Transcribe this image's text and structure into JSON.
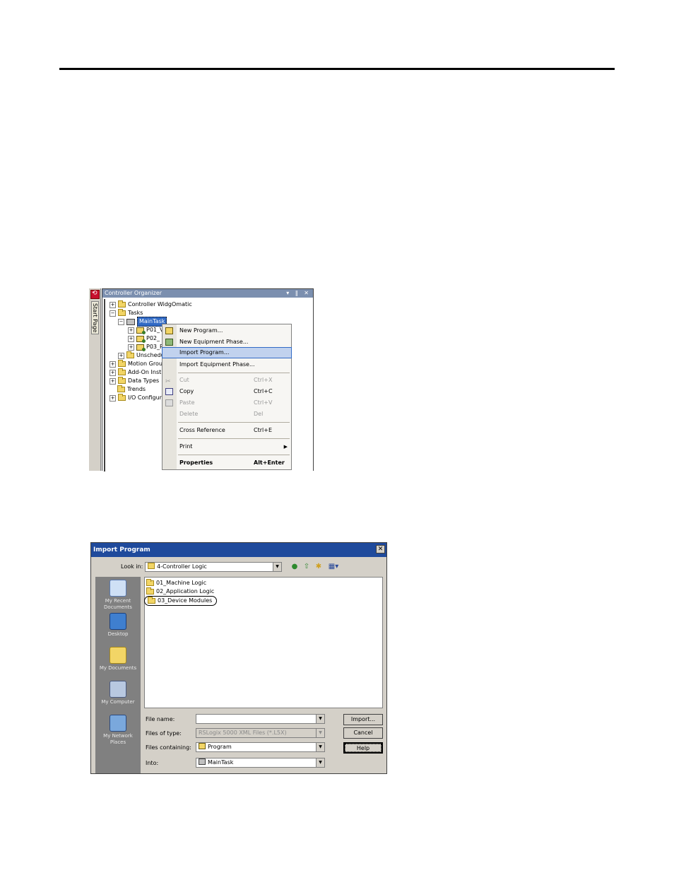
{
  "organizer": {
    "title": "Controller Organizer",
    "title_controls": "▾ ‖ ✕",
    "start_page_label": "Start Page",
    "tree": [
      {
        "label": "Controller WidgOmatic"
      },
      {
        "label": "Tasks"
      },
      {
        "label": "MainTask"
      },
      {
        "label": "P01_V"
      },
      {
        "label": "P02_"
      },
      {
        "label": "P03_P"
      },
      {
        "label": "Unschedul"
      },
      {
        "label": "Motion Groups"
      },
      {
        "label": "Add-On Instru"
      },
      {
        "label": "Data Types"
      },
      {
        "label": "Trends"
      },
      {
        "label": "I/O Configurat"
      }
    ]
  },
  "context_menu": {
    "items": [
      {
        "label": "New Program...",
        "shortcut": ""
      },
      {
        "label": "New Equipment Phase...",
        "shortcut": ""
      },
      {
        "label": "Import Program...",
        "shortcut": ""
      },
      {
        "label": "Import Equipment Phase...",
        "shortcut": ""
      },
      {
        "label": "Cut",
        "shortcut": "Ctrl+X"
      },
      {
        "label": "Copy",
        "shortcut": "Ctrl+C"
      },
      {
        "label": "Paste",
        "shortcut": "Ctrl+V"
      },
      {
        "label": "Delete",
        "shortcut": "Del"
      },
      {
        "label": "Cross Reference",
        "shortcut": "Ctrl+E"
      },
      {
        "label": "Print",
        "shortcut": ""
      },
      {
        "label": "Properties",
        "shortcut": "Alt+Enter"
      }
    ]
  },
  "dialog": {
    "title": "Import Program",
    "close": "✕",
    "look_in_label": "Look in:",
    "look_in_value": "4-Controller Logic",
    "places": [
      {
        "label": "My Recent Documents"
      },
      {
        "label": "Desktop"
      },
      {
        "label": "My Documents"
      },
      {
        "label": "My Computer"
      },
      {
        "label": "My Network Places"
      }
    ],
    "files": [
      {
        "name": "01_Machine Logic"
      },
      {
        "name": "02_Application Logic"
      },
      {
        "name": "03_Device Modules"
      }
    ],
    "file_name_label": "File name:",
    "file_name_value": "",
    "files_of_type_label": "Files of type:",
    "files_of_type_value": "RSLogix 5000 XML Files (*.L5X)",
    "files_containing_label": "Files containing:",
    "files_containing_value": "Program",
    "into_label": "Into:",
    "into_value": "MainTask",
    "buttons": {
      "import": "Import...",
      "cancel": "Cancel",
      "help": "Help"
    }
  },
  "colors": {
    "title_bar": "#1f4a9c",
    "highlight": "#c1d2ee",
    "selection": "#316ac5"
  }
}
